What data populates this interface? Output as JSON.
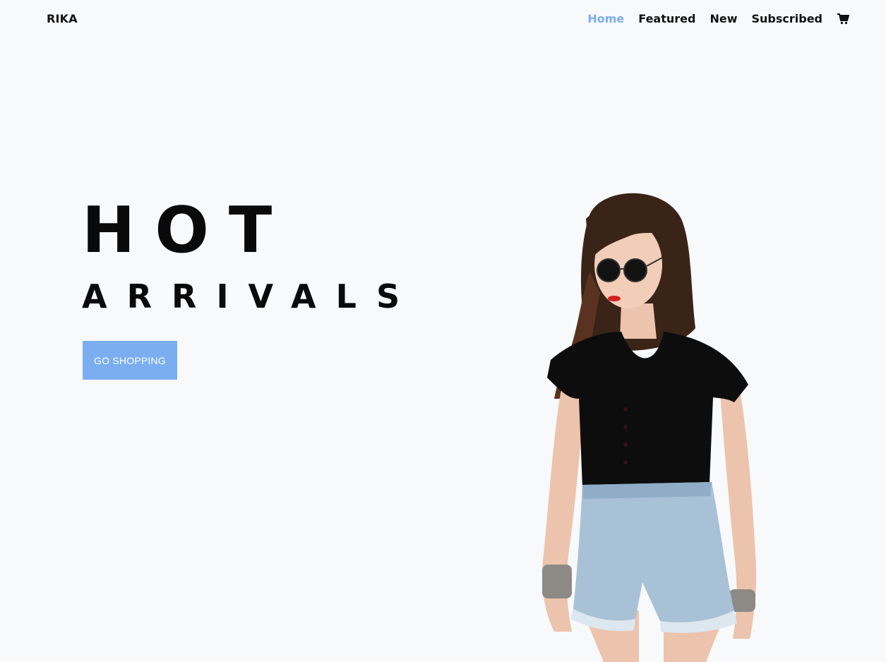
{
  "brand": {
    "name": "RIKA"
  },
  "nav": {
    "items": [
      {
        "label": "Home",
        "active": true
      },
      {
        "label": "Featured",
        "active": false
      },
      {
        "label": "New",
        "active": false
      },
      {
        "label": "Subscribed",
        "active": false
      }
    ],
    "cart_icon": "shopping-cart-icon"
  },
  "hero": {
    "title": "HOT",
    "subtitle": "ARRIVALS",
    "cta_label": "GO SHOPPING",
    "image": "model-photo"
  },
  "colors": {
    "accent": "#7aaef0",
    "background": "#f8f9fb",
    "text": "#0a0a0a"
  }
}
